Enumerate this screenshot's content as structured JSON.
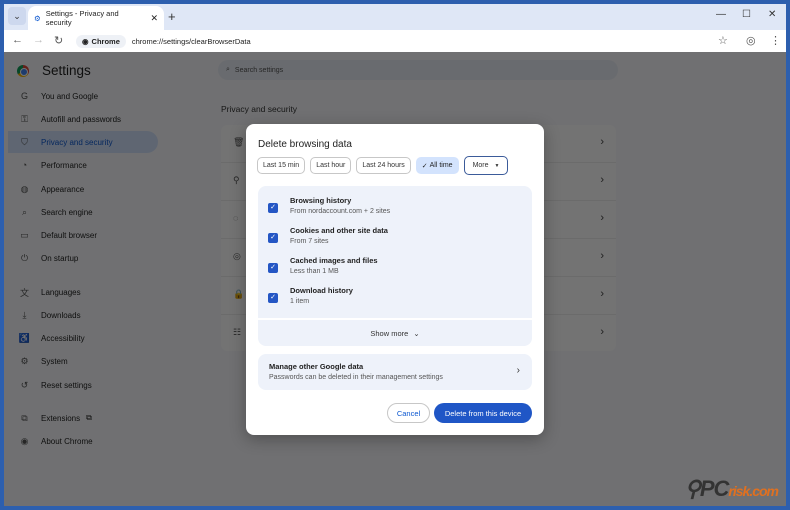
{
  "browser": {
    "tab_title": "Settings - Privacy and security",
    "chip": "Chrome",
    "url": "chrome://settings/clearBrowserData"
  },
  "settings": {
    "title": "Settings",
    "search_placeholder": "Search settings",
    "section": "Privacy and security",
    "nav": [
      {
        "label": "You and Google",
        "icon": "G"
      },
      {
        "label": "Autofill and passwords",
        "icon": "⚿"
      },
      {
        "label": "Privacy and security",
        "icon": "⛉"
      },
      {
        "label": "Performance",
        "icon": "◔"
      },
      {
        "label": "Appearance",
        "icon": "◍"
      },
      {
        "label": "Search engine",
        "icon": "⌕"
      },
      {
        "label": "Default browser",
        "icon": "▭"
      },
      {
        "label": "On startup",
        "icon": "⏻"
      },
      {
        "label": "Languages",
        "icon": "文"
      },
      {
        "label": "Downloads",
        "icon": "⤓"
      },
      {
        "label": "Accessibility",
        "icon": "♿"
      },
      {
        "label": "System",
        "icon": "⚙"
      },
      {
        "label": "Reset settings",
        "icon": "↺"
      },
      {
        "label": "Extensions",
        "icon": "⧉"
      },
      {
        "label": "About Chrome",
        "icon": "◉"
      }
    ]
  },
  "dialog": {
    "title": "Delete browsing data",
    "ranges": [
      "Last 15 min",
      "Last hour",
      "Last 24 hours",
      "All time"
    ],
    "more": "More",
    "items": [
      {
        "title": "Browsing history",
        "sub": "From nordaccount.com + 2 sites"
      },
      {
        "title": "Cookies and other site data",
        "sub": "From 7 sites"
      },
      {
        "title": "Cached images and files",
        "sub": "Less than 1 MB"
      },
      {
        "title": "Download history",
        "sub": "1 item"
      }
    ],
    "show_more": "Show more",
    "manage_title": "Manage other Google data",
    "manage_sub": "Passwords can be deleted in their management settings",
    "cancel": "Cancel",
    "delete": "Delete from this device"
  },
  "watermark": {
    "pc": "PC",
    "risk": "risk.com"
  }
}
